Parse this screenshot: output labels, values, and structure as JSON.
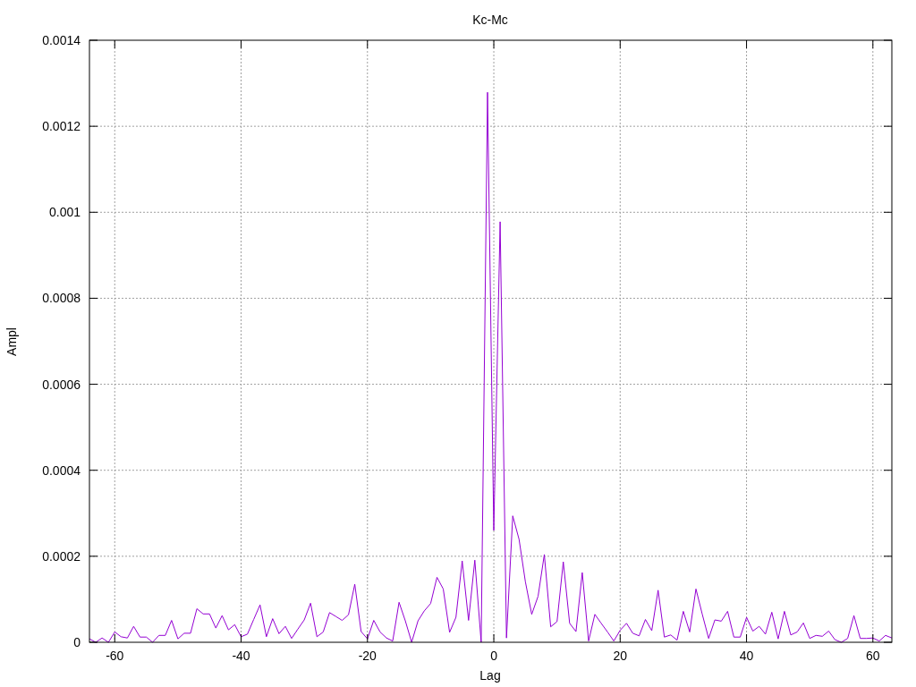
{
  "chart_data": {
    "type": "line",
    "title": "Kc-Mc",
    "xlabel": "Lag",
    "ylabel": "Ampl",
    "grid": true,
    "xlim": [
      -64,
      63
    ],
    "ylim": [
      0,
      0.0014
    ],
    "xticks": [
      -60,
      -40,
      -20,
      0,
      20,
      40,
      60
    ],
    "yticks": [
      0,
      0.0002,
      0.0004,
      0.0006,
      0.0008,
      0.001,
      0.0012,
      0.0014
    ],
    "x": [
      -64,
      -63,
      -62,
      -61,
      -60,
      -59,
      -58,
      -57,
      -56,
      -55,
      -54,
      -53,
      -52,
      -51,
      -50,
      -49,
      -48,
      -47,
      -46,
      -45,
      -44,
      -43,
      -42,
      -41,
      -40,
      -39,
      -38,
      -37,
      -36,
      -35,
      -34,
      -33,
      -32,
      -31,
      -30,
      -29,
      -28,
      -27,
      -26,
      -25,
      -24,
      -23,
      -22,
      -21,
      -20,
      -19,
      -18,
      -17,
      -16,
      -15,
      -14,
      -13,
      -12,
      -11,
      -10,
      -9,
      -8,
      -7,
      -6,
      -5,
      -4,
      -3,
      -2,
      -1,
      0,
      1,
      2,
      3,
      4,
      5,
      6,
      7,
      8,
      9,
      10,
      11,
      12,
      13,
      14,
      15,
      16,
      17,
      18,
      19,
      20,
      21,
      22,
      23,
      24,
      25,
      26,
      27,
      28,
      29,
      30,
      31,
      32,
      33,
      34,
      35,
      36,
      37,
      38,
      39,
      40,
      41,
      42,
      43,
      44,
      45,
      46,
      47,
      48,
      49,
      50,
      51,
      52,
      53,
      54,
      55,
      56,
      57,
      58,
      59,
      60,
      61,
      62,
      63
    ],
    "series": [
      {
        "color": "#9400d3",
        "values": [
          8e-06,
          0,
          1e-05,
          0,
          2.4e-05,
          1.3e-05,
          1e-05,
          3.7e-05,
          1.2e-05,
          1.2e-05,
          0,
          1.6e-05,
          1.6e-05,
          5.1e-05,
          8e-06,
          2.1e-05,
          2.1e-05,
          7.8e-05,
          6.6e-05,
          6.6e-05,
          3.3e-05,
          6.2e-05,
          2.9e-05,
          4.1e-05,
          1.3e-05,
          1.9e-05,
          5.3e-05,
          8.7e-05,
          1.3e-05,
          5.5e-05,
          2e-05,
          3.7e-05,
          9e-06,
          3.1e-05,
          5.2e-05,
          9.1e-05,
          1.3e-05,
          2.4e-05,
          6.9e-05,
          6e-05,
          5.1e-05,
          6.4e-05,
          0.000135,
          2.5e-05,
          8e-06,
          5.1e-05,
          2.4e-05,
          1e-05,
          3e-06,
          9.3e-05,
          5e-05,
          0,
          5e-05,
          7.3e-05,
          9e-05,
          0.000151,
          0.000124,
          2.3e-05,
          5.8e-05,
          0.000189,
          5.1e-05,
          0.000191,
          0,
          0.001279,
          0.00026,
          0.000978,
          1e-05,
          0.000294,
          0.000239,
          0.000141,
          6.5e-05,
          0.000107,
          0.000204,
          3.6e-05,
          4.8e-05,
          0.000187,
          4.4e-05,
          2.5e-05,
          0.000162,
          3e-06,
          6.5e-05,
          4.4e-05,
          2.4e-05,
          3e-06,
          2.8e-05,
          4.4e-05,
          2.1e-05,
          1.5e-05,
          5.3e-05,
          2.7e-05,
          0.000121,
          1.2e-05,
          1.7e-05,
          5e-06,
          7.2e-05,
          2.4e-05,
          0.000124,
          6.5e-05,
          9e-06,
          5.2e-05,
          4.9e-05,
          7.2e-05,
          1.2e-05,
          1.2e-05,
          5.8e-05,
          2.6e-05,
          3.7e-05,
          1.9e-05,
          7e-05,
          8e-06,
          7.2e-05,
          1.7e-05,
          2.4e-05,
          4.5e-05,
          9e-06,
          1.6e-05,
          1.4e-05,
          2.6e-05,
          6e-06,
          0,
          9e-06,
          6.2e-05,
          9e-06,
          9e-06,
          1e-05,
          3e-06,
          1.6e-05,
          1e-05
        ]
      }
    ]
  }
}
